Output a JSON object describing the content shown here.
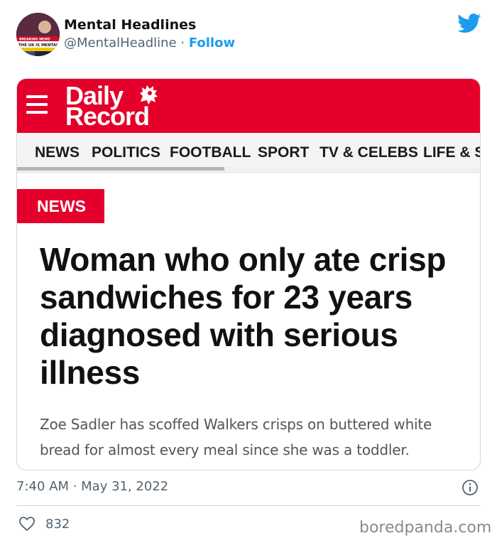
{
  "tweet": {
    "author_name": "Mental Headlines",
    "author_handle": "@MentalHeadline",
    "separator": " · ",
    "follow_label": "Follow",
    "avatar": {
      "banner_top": "BREAKING NEWS",
      "banner_main": "THE UK IS MENTAL"
    },
    "timestamp": "7:40 AM · May 31, 2022",
    "likes": "832"
  },
  "article": {
    "logo_line1": "Daily",
    "logo_line2": "Record",
    "nav": [
      "NEWS",
      "POLITICS",
      "FOOTBALL",
      "SPORT",
      "TV & CELEBS",
      "LIFE & ST"
    ],
    "section_tag": "NEWS",
    "headline": "Woman who only ate crisp sandwiches for 23 years diagnosed with serious illness",
    "standfirst": "Zoe Sadler has scoffed Walkers crisps on buttered white bread for almost every meal since she was a toddler."
  },
  "watermark": "boredpanda.com",
  "colors": {
    "brand_red": "#e4002b",
    "twitter_blue": "#1d9bf0",
    "muted_text": "#536471"
  },
  "icons": [
    "twitter-bird-icon",
    "hamburger-menu-icon",
    "lion-crest-icon",
    "info-icon",
    "heart-icon"
  ]
}
